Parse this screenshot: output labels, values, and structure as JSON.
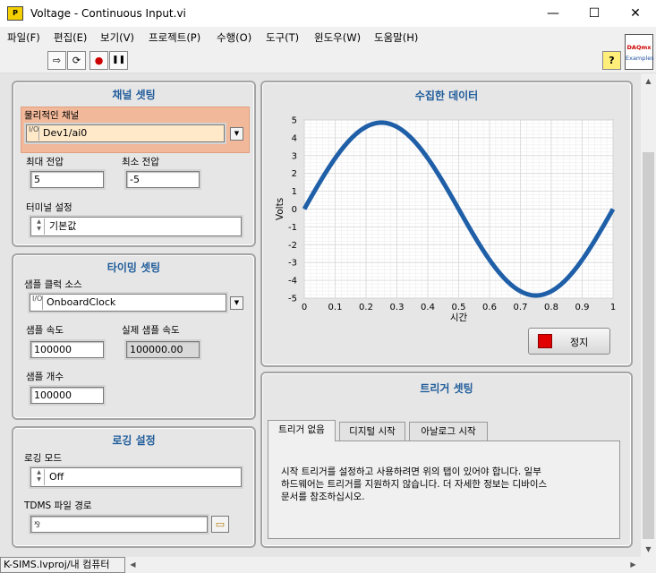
{
  "window": {
    "title": "Voltage - Continuous Input.vi",
    "minimize": "—",
    "maximize": "☐",
    "close": "✕",
    "app_icon": "P"
  },
  "menu": [
    "파일(F)",
    "편집(E)",
    "보기(V)",
    "프로젝트(P)",
    "수행(O)",
    "도구(T)",
    "윈도우(W)",
    "도움말(H)"
  ],
  "toolbar": {
    "run": "⇨",
    "run_continuous": "⟳",
    "abort": "●",
    "pause": "❚❚",
    "help": "?",
    "badge_top": "DAQmx",
    "badge_bottom": "Examples"
  },
  "channel": {
    "title": "채널 셋팅",
    "physical_label": "물리적인 채널",
    "physical_value": "Dev1/ai0",
    "max_label": "최대 전압",
    "max_value": "5",
    "min_label": "최소 전압",
    "min_value": "-5",
    "terminal_label": "터미널 설정",
    "terminal_value": "기본값"
  },
  "timing": {
    "title": "타이밍 셋팅",
    "clock_label": "샘플 클럭 소스",
    "clock_value": "OnboardClock",
    "rate_label": "샘플 속도",
    "rate_value": "100000",
    "actual_label": "실제 샘플 속도",
    "actual_value": "100000.00",
    "count_label": "샘플 개수",
    "count_value": "100000"
  },
  "logging": {
    "title": "로깅 설정",
    "mode_label": "로깅 모드",
    "mode_value": "Off",
    "path_label": "TDMS 파일 경로",
    "path_value": ""
  },
  "graph": {
    "title": "수집한 데이터",
    "stop_label": "정지"
  },
  "trigger": {
    "title": "트리거 셋팅",
    "tabs": [
      "트리거 없음",
      "디지털 시작",
      "아날로그 시작"
    ],
    "message_line1": "시작 트리거를 설정하고 사용하려면 위의 탭이 있어야 합니다.  일부",
    "message_line2": "하드웨어는 트리거를 지원하지 않습니다. 더 자세한 정보는 디바이스",
    "message_line3": "문서를 참조하십시오."
  },
  "status_bar": {
    "project": "K-SIMS.lvproj/내 컴퓨터"
  },
  "chart_data": {
    "type": "line",
    "xlabel": "시간",
    "ylabel": "Volts",
    "xlim": [
      0,
      1
    ],
    "ylim": [
      -5,
      5
    ],
    "xticks": [
      "0",
      "0.1",
      "0.2",
      "0.3",
      "0.4",
      "0.5",
      "0.6",
      "0.7",
      "0.8",
      "0.9",
      "1"
    ],
    "yticks": [
      "5",
      "4",
      "3",
      "2",
      "1",
      "0",
      "-1",
      "-2",
      "-3",
      "-4",
      "-5"
    ],
    "grid": true,
    "series": [
      {
        "amplitude": 4.85,
        "frequency": 1,
        "x": [
          0,
          0.05,
          0.1,
          0.15,
          0.2,
          0.25,
          0.3,
          0.35,
          0.4,
          0.45,
          0.5,
          0.55,
          0.6,
          0.65,
          0.7,
          0.75,
          0.8,
          0.85,
          0.9,
          0.95,
          1.0
        ],
        "y": [
          0,
          1.5,
          2.85,
          3.92,
          4.61,
          4.85,
          4.61,
          3.92,
          2.85,
          1.5,
          0,
          -1.5,
          -2.85,
          -3.92,
          -4.61,
          -4.85,
          -4.61,
          -3.92,
          -2.85,
          -1.5,
          0
        ]
      }
    ],
    "colors": {
      "line": "#1f5fa8",
      "plot_bg": "#ffffff",
      "grid": "#d8d8d8"
    }
  }
}
